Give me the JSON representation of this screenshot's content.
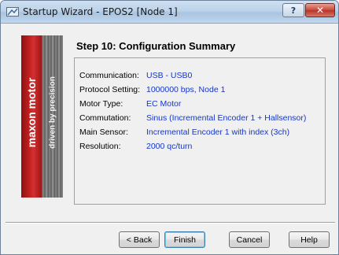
{
  "window": {
    "title": "Startup Wizard - EPOS2 [Node 1]",
    "icon": "wizard-icon",
    "help_glyph": "?",
    "close_glyph": "✕"
  },
  "sidebar": {
    "brand": "maxon motor",
    "tagline": "driven by precision"
  },
  "step": {
    "title": "Step 10: Configuration Summary"
  },
  "summary": {
    "rows": [
      {
        "label": "Communication:",
        "value": "USB - USB0"
      },
      {
        "label": "Protocol Setting:",
        "value": "1000000 bps, Node 1"
      },
      {
        "label": "Motor Type:",
        "value": "EC Motor"
      },
      {
        "label": "Commutation:",
        "value": "Sinus (Incremental Encoder 1 + Hallsensor)"
      },
      {
        "label": "Main Sensor:",
        "value": "Incremental Encoder 1 with index (3ch)"
      },
      {
        "label": "Resolution:",
        "value": "2000 qc/turn"
      }
    ]
  },
  "buttons": {
    "back": "< Back",
    "finish": "Finish",
    "cancel": "Cancel",
    "help": "Help"
  },
  "colors": {
    "value_text": "#1636c8",
    "brand_red": "#c42020"
  }
}
